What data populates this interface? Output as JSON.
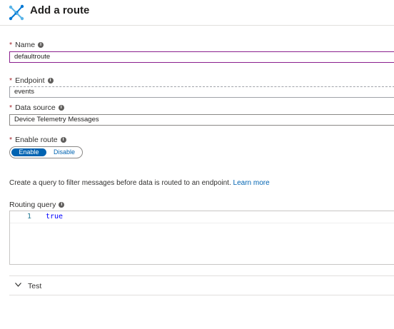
{
  "header": {
    "title": "Add a route",
    "icon": "route-icon"
  },
  "form": {
    "name": {
      "required_mark": "*",
      "label": "Name",
      "value": "defaultroute"
    },
    "endpoint": {
      "required_mark": "*",
      "label": "Endpoint",
      "value": "events"
    },
    "data_source": {
      "required_mark": "*",
      "label": "Data source",
      "value": "Device Telemetry Messages"
    },
    "enable_route": {
      "required_mark": "*",
      "label": "Enable route",
      "on_label": "Enable",
      "off_label": "Disable",
      "selected": "Enable"
    },
    "description": {
      "text": "Create a query to filter messages before data is routed to an endpoint.",
      "link": "Learn more"
    },
    "routing_query": {
      "label": "Routing query",
      "line_number": "1",
      "code": "true"
    },
    "test": {
      "label": "Test"
    }
  },
  "colors": {
    "accent": "#0063b1",
    "required": "#a4262c",
    "name_border": "#8a1f8e"
  }
}
